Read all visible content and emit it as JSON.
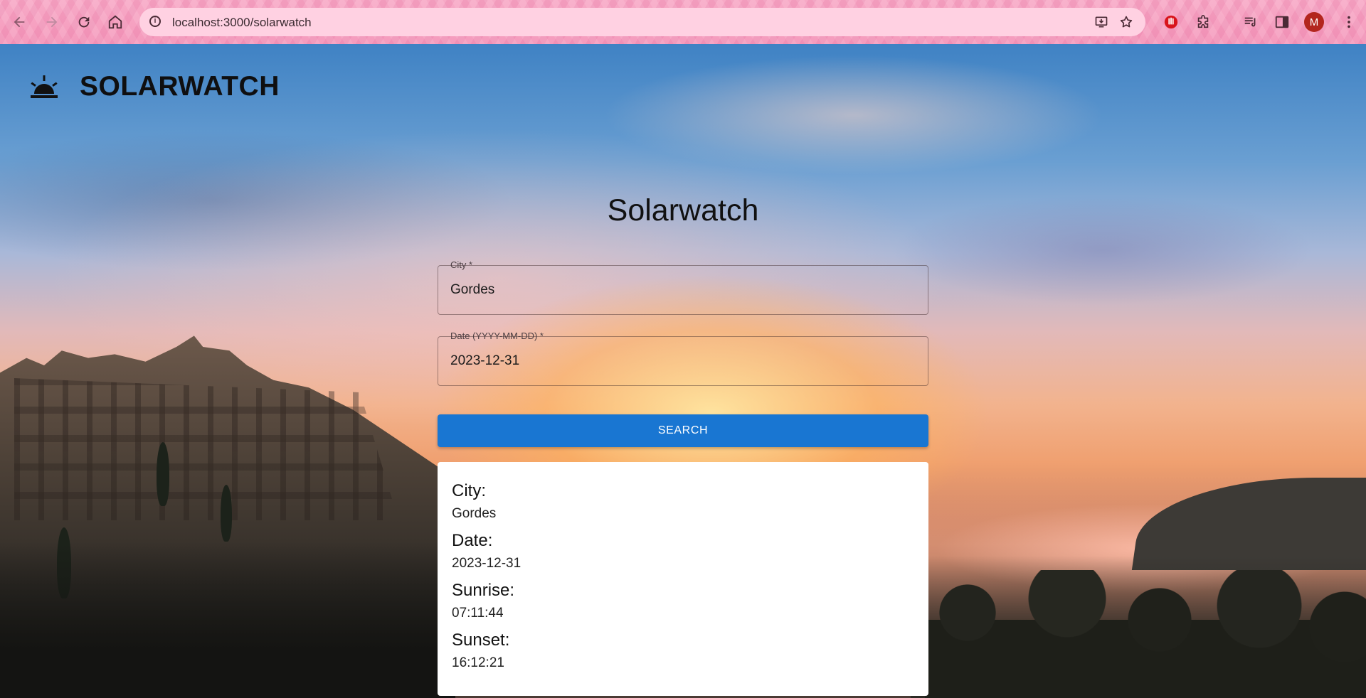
{
  "browser": {
    "url": "localhost:3000/solarwatch",
    "profile_initial": "M",
    "icons": [
      "back-icon",
      "forward-icon",
      "reload-icon",
      "home-icon",
      "site-info-icon",
      "install-app-icon",
      "bookmark-star-icon",
      "extension-red-icon",
      "extensions-puzzle-icon",
      "media-queue-icon",
      "side-panel-icon",
      "menu-kebab-icon"
    ]
  },
  "brand": {
    "name": "SOLARWATCH",
    "icon": "sunrise-icon"
  },
  "page": {
    "title": "Solarwatch"
  },
  "form": {
    "city": {
      "label": "City *",
      "value": "Gordes"
    },
    "date": {
      "label": "Date (YYYY-MM-DD) *",
      "value": "2023-12-31"
    },
    "search_label": "SEARCH"
  },
  "result": {
    "city_label": "City:",
    "city_value": "Gordes",
    "date_label": "Date:",
    "date_value": "2023-12-31",
    "sunrise_label": "Sunrise:",
    "sunrise_value": "07:11:44",
    "sunset_label": "Sunset:",
    "sunset_value": "16:12:21"
  },
  "colors": {
    "primary": "#1976d2",
    "chrome": "#f7a9c6",
    "avatar": "#b3261e"
  }
}
